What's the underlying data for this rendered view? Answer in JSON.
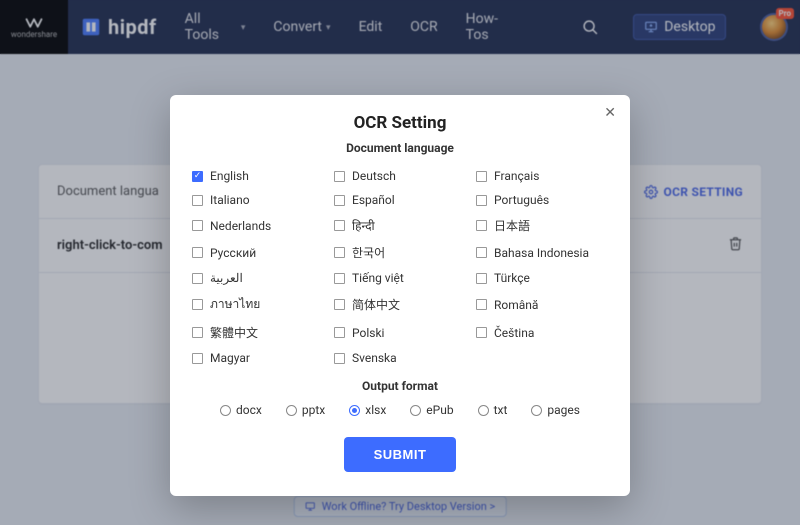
{
  "wondershare_label": "wondershare",
  "brand": "hipdf",
  "nav": {
    "all_tools": "All Tools",
    "convert": "Convert",
    "edit": "Edit",
    "ocr": "OCR",
    "howtos": "How-Tos"
  },
  "desktop_btn": "Desktop",
  "pro_badge": "Pro",
  "card": {
    "doc_lang_label": "Document langua",
    "file_row": "right-click-to-com",
    "ocr_setting": "OCR SETTING"
  },
  "bottom_link": "Work Offline? Try Desktop Version >",
  "modal": {
    "title": "OCR Setting",
    "subtitle": "Document language",
    "languages_col1": [
      "English",
      "Italiano",
      "Nederlands",
      "Русский",
      "العربية",
      "ภาษาไทย",
      "繁體中文",
      "Magyar"
    ],
    "languages_col2": [
      "Deutsch",
      "Español",
      "हिन्दी",
      "한국어",
      "Tiếng việt",
      "简体中文",
      "Polski",
      "Svenska"
    ],
    "languages_col3": [
      "Français",
      "Português",
      "日本語",
      "Bahasa Indonesia",
      "Türkçe",
      "Română",
      "Čeština"
    ],
    "checked_index": 0,
    "output_title": "Output format",
    "formats": [
      "docx",
      "pptx",
      "xlsx",
      "ePub",
      "txt",
      "pages"
    ],
    "selected_format_index": 2,
    "submit": "SUBMIT"
  }
}
